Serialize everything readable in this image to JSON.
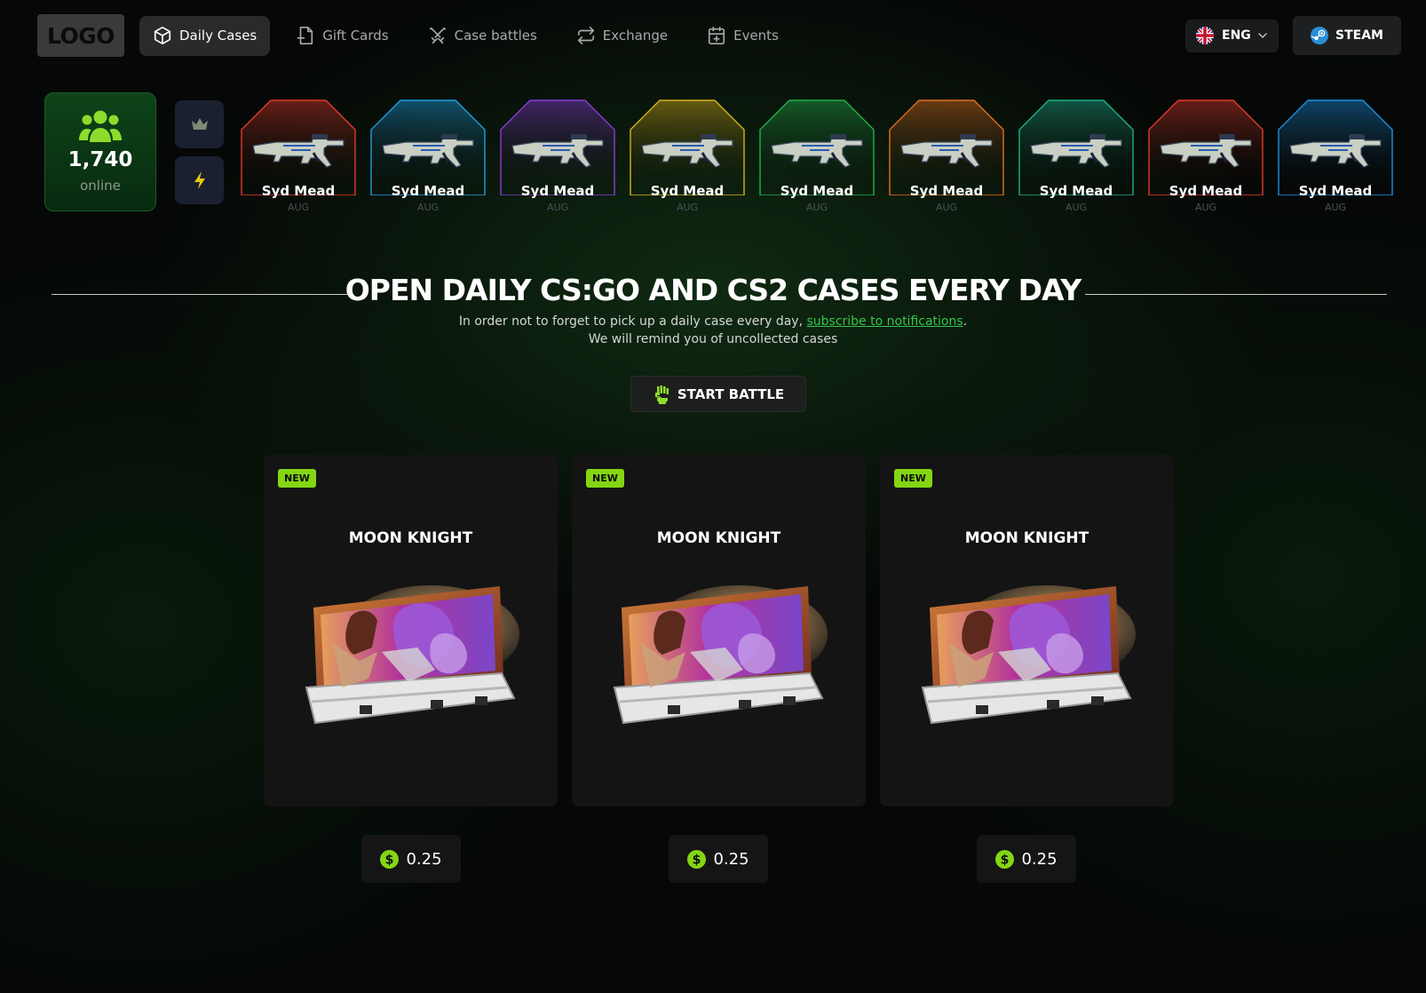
{
  "header": {
    "logo": "LOGO",
    "nav": [
      {
        "label": "Daily Cases",
        "icon": "box-icon",
        "active": true
      },
      {
        "label": "Gift Cards",
        "icon": "file-icon",
        "active": false
      },
      {
        "label": "Case battles",
        "icon": "crossed-swords-icon",
        "active": false
      },
      {
        "label": "Exchange",
        "icon": "exchange-icon",
        "active": false
      },
      {
        "label": "Events",
        "icon": "calendar-icon",
        "active": false
      }
    ],
    "language": "ENG",
    "steam_label": "STEAM"
  },
  "online": {
    "count": "1,740",
    "label": "online"
  },
  "live_drops": [
    {
      "name": "Syd Mead",
      "type": "AUG",
      "color": "#e23a2b"
    },
    {
      "name": "Syd Mead",
      "type": "AUG",
      "color": "#1f9fe0"
    },
    {
      "name": "Syd Mead",
      "type": "AUG",
      "color": "#8a3bd6"
    },
    {
      "name": "Syd Mead",
      "type": "AUG",
      "color": "#d7b21a"
    },
    {
      "name": "Syd Mead",
      "type": "AUG",
      "color": "#22b04a"
    },
    {
      "name": "Syd Mead",
      "type": "AUG",
      "color": "#e0701f"
    },
    {
      "name": "Syd Mead",
      "type": "AUG",
      "color": "#1fae8a"
    },
    {
      "name": "Syd Mead",
      "type": "AUG",
      "color": "#e23a2b"
    },
    {
      "name": "Syd Mead",
      "type": "AUG",
      "color": "#1f8fe0"
    }
  ],
  "hero": {
    "title": "OPEN DAILY CS:GO AND CS2 CASES EVERY DAY",
    "sub_line1_prefix": "In order not to forget to pick up a daily case every day, ",
    "sub_link": "subscribe to notifications",
    "sub_line1_suffix": ".",
    "sub_line2": "We will remind you of uncollected cases",
    "battle_label": "START BATTLE"
  },
  "cases": [
    {
      "badge": "NEW",
      "title": "MOON KNIGHT",
      "price": "0.25"
    },
    {
      "badge": "NEW",
      "title": "MOON KNIGHT",
      "price": "0.25"
    },
    {
      "badge": "NEW",
      "title": "MOON KNIGHT",
      "price": "0.25"
    }
  ],
  "colors": {
    "accent": "#84d613",
    "link": "#37c64a",
    "online_bg": "#0e4418"
  }
}
